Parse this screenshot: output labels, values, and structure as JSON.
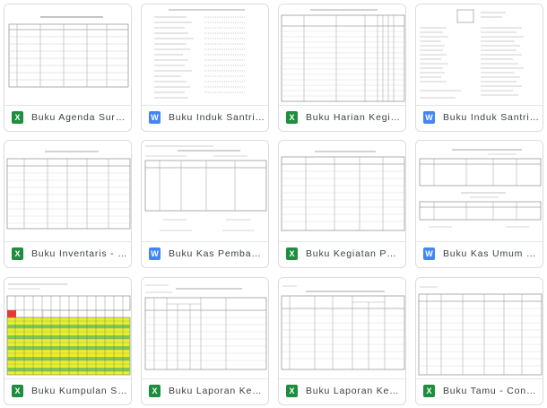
{
  "files": [
    {
      "title": "Buku Agenda Surat Keluar...",
      "type": "X",
      "color": "#1e8e3e"
    },
    {
      "title": "Buku Induk Santri - Buku...",
      "type": "W",
      "color": "#4285f4"
    },
    {
      "title": "Buku Harian Kegiatan K...",
      "type": "X",
      "color": "#1e8e3e"
    },
    {
      "title": "Buku Induk Santri - Buku...",
      "type": "W",
      "color": "#4285f4"
    },
    {
      "title": "Buku Inventaris - Contoh...",
      "type": "X",
      "color": "#1e8e3e"
    },
    {
      "title": "Buku Kas Pembantu - B...",
      "type": "W",
      "color": "#4285f4"
    },
    {
      "title": "Buku Kegiatan Pendidik...",
      "type": "X",
      "color": "#1e8e3e"
    },
    {
      "title": "Buku Kas Umum - Buku ...",
      "type": "W",
      "color": "#4285f4"
    },
    {
      "title": "Buku Kumpulan Santri - ...",
      "type": "X",
      "color": "#1e8e3e"
    },
    {
      "title": "Buku Laporan Keadaan ...",
      "type": "X",
      "color": "#1e8e3e"
    },
    {
      "title": "Buku Laporan Keadaan ...",
      "type": "X",
      "color": "#1e8e3e"
    },
    {
      "title": "Buku Tamu - Contoh Bu...",
      "type": "X",
      "color": "#1e8e3e"
    }
  ]
}
